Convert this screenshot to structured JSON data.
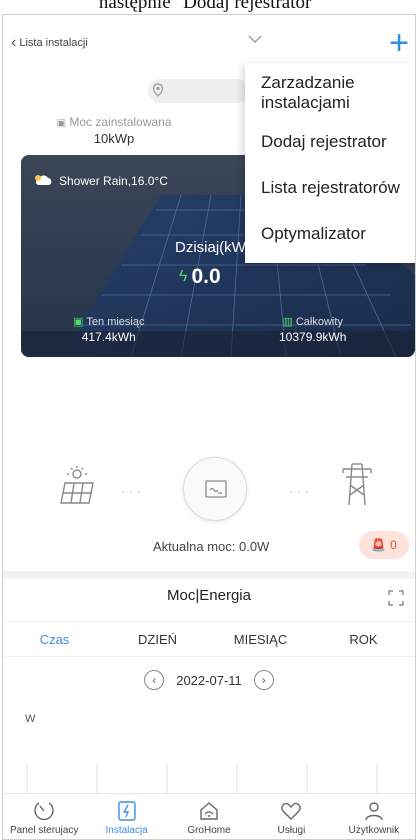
{
  "caption": "następnie \"Dodaj rejestrator\"",
  "header": {
    "back_label": "Lista instalacji"
  },
  "capacity": {
    "label": "Moc zainstalowana",
    "value": "10kWp"
  },
  "menu": {
    "items": [
      {
        "label": "Zarzadzanie instalacjami"
      },
      {
        "label": "Dodaj rejestrator"
      },
      {
        "label": "Lista rejestratorów"
      },
      {
        "label": "Optymalizator"
      }
    ]
  },
  "hero": {
    "weather": "Shower Rain,16.0°C",
    "today_label": "Dzisiaj(kW",
    "today_value": "0.0",
    "month_label": "Ten miesiąc",
    "month_value": "417.4kWh",
    "total_label": "Całkowity",
    "total_value": "10379.9kWh"
  },
  "flow": {
    "actual_power": "Aktualna moc: 0.0W",
    "alarm_count": "0"
  },
  "energy": {
    "title": "Moc|Energia",
    "tabs": [
      {
        "label": "Czas",
        "active": true
      },
      {
        "label": "DZIEŃ",
        "active": false
      },
      {
        "label": "MIESIĄC",
        "active": false
      },
      {
        "label": "ROK",
        "active": false
      }
    ],
    "date": "2022-07-11",
    "axis_unit": "W"
  },
  "nav": {
    "items": [
      {
        "label": "Panel sterujacy",
        "icon": "dashboard-icon",
        "active": false
      },
      {
        "label": "Instalacja",
        "icon": "plant-icon",
        "active": true
      },
      {
        "label": "GroHome",
        "icon": "home-icon",
        "active": false
      },
      {
        "label": "Usługi",
        "icon": "service-icon",
        "active": false
      },
      {
        "label": "Użytkownik",
        "icon": "user-icon",
        "active": false
      }
    ]
  },
  "colors": {
    "accent": "#3c8ee3",
    "alarm": "#e74c2e"
  }
}
